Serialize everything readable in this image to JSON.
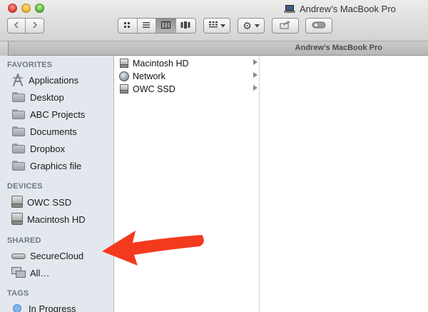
{
  "window": {
    "title": "Andrew’s MacBook Pro",
    "tab_title": "Andrew’s MacBook Pro"
  },
  "toolbar": {
    "back_icon": "chevron-left-icon",
    "forward_icon": "chevron-right-icon",
    "view_icons": [
      "icon-view-icon",
      "list-view-icon",
      "column-view-icon",
      "cover-flow-icon"
    ],
    "active_view": "column-view-icon",
    "arrange_icon": "grid-arrange-icon",
    "action_icon": "gear-icon",
    "share_icon": "share-icon",
    "tags_icon": "tag-pill-icon"
  },
  "sidebar": {
    "favorites": {
      "heading": "FAVORITES",
      "items": [
        {
          "label": "Applications",
          "icon": "applications-icon"
        },
        {
          "label": "Desktop",
          "icon": "folder-icon"
        },
        {
          "label": "ABC Projects",
          "icon": "folder-icon"
        },
        {
          "label": "Documents",
          "icon": "folder-icon"
        },
        {
          "label": "Dropbox",
          "icon": "folder-icon"
        },
        {
          "label": "Graphics file",
          "icon": "folder-icon"
        }
      ]
    },
    "devices": {
      "heading": "DEVICES",
      "items": [
        {
          "label": "OWC SSD",
          "icon": "drive-icon"
        },
        {
          "label": "Macintosh HD",
          "icon": "drive-icon"
        }
      ]
    },
    "shared": {
      "heading": "SHARED",
      "items": [
        {
          "label": "SecureCloud",
          "icon": "cloud-server-icon"
        },
        {
          "label": "All…",
          "icon": "network-icon"
        }
      ]
    },
    "tags": {
      "heading": "TAGS",
      "items": [
        {
          "label": "In Progress",
          "icon": "tag-dot-icon",
          "color": "#7fb7ea"
        }
      ]
    }
  },
  "column1": {
    "items": [
      {
        "label": "Macintosh HD",
        "icon": "drive-icon"
      },
      {
        "label": "Network",
        "icon": "globe-icon"
      },
      {
        "label": "OWC SSD",
        "icon": "drive-icon"
      }
    ]
  },
  "annotation": {
    "arrow_color": "#f33a1e"
  }
}
